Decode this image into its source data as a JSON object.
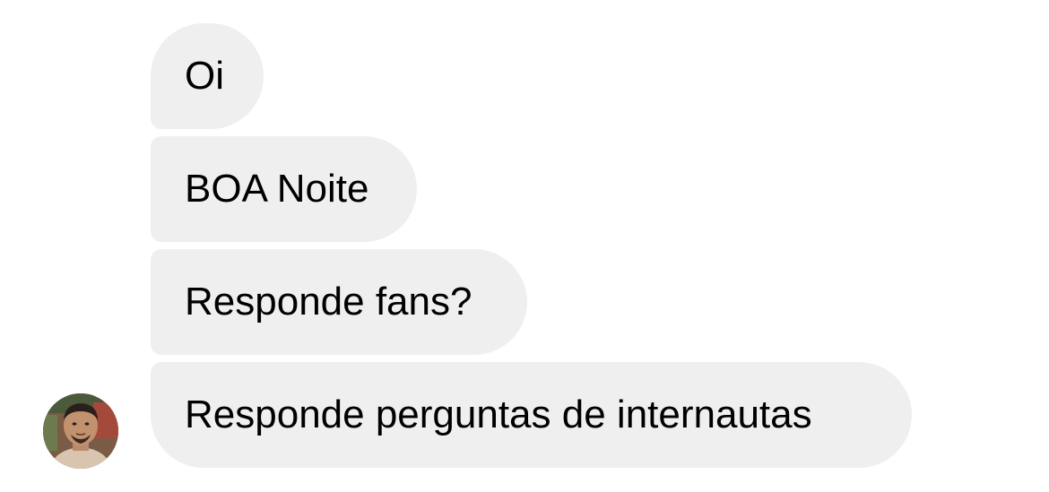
{
  "conversation": {
    "messages": [
      {
        "text": "Oi"
      },
      {
        "text": "BOA Noite"
      },
      {
        "text": "Responde fans?"
      },
      {
        "text": "Responde perguntas de internautas"
      }
    ],
    "sender": {
      "avatar_icon": "user-photo-avatar"
    }
  },
  "colors": {
    "bubble_background": "#efefef",
    "text": "#000000",
    "page_background": "#ffffff"
  }
}
